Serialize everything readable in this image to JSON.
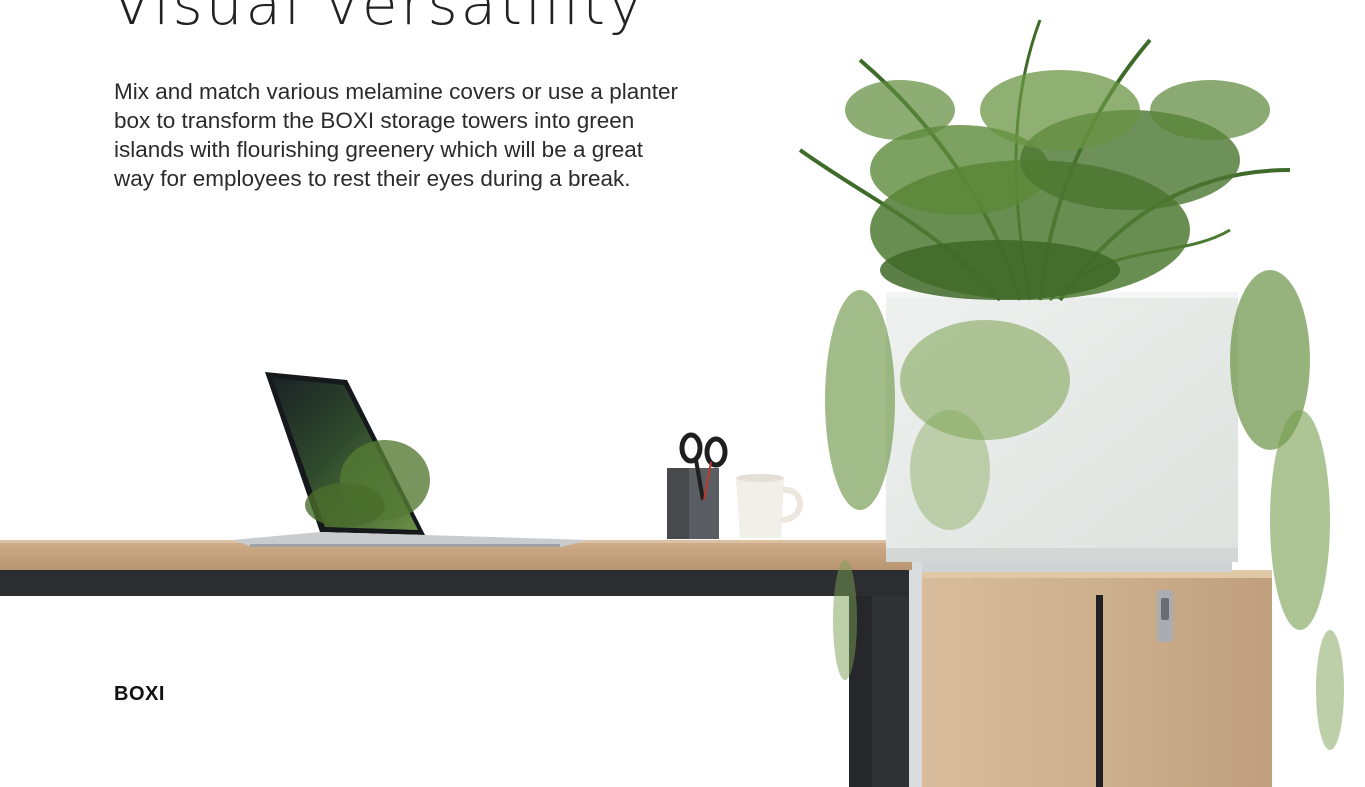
{
  "page": {
    "heading": "Visual versatility",
    "body": "Mix and match various melamine covers or use a planter box to transform the BOXI storage towers into green islands with flourishing greenery which will be a great way for employees to rest their eyes during a break.",
    "product_name": "BOXI"
  },
  "colors": {
    "text": "#2b2b2b",
    "wood": "#c9a985",
    "frame": "#2b2d30",
    "planter": "#e6e9e7",
    "foliage": "#5a7a3a"
  }
}
